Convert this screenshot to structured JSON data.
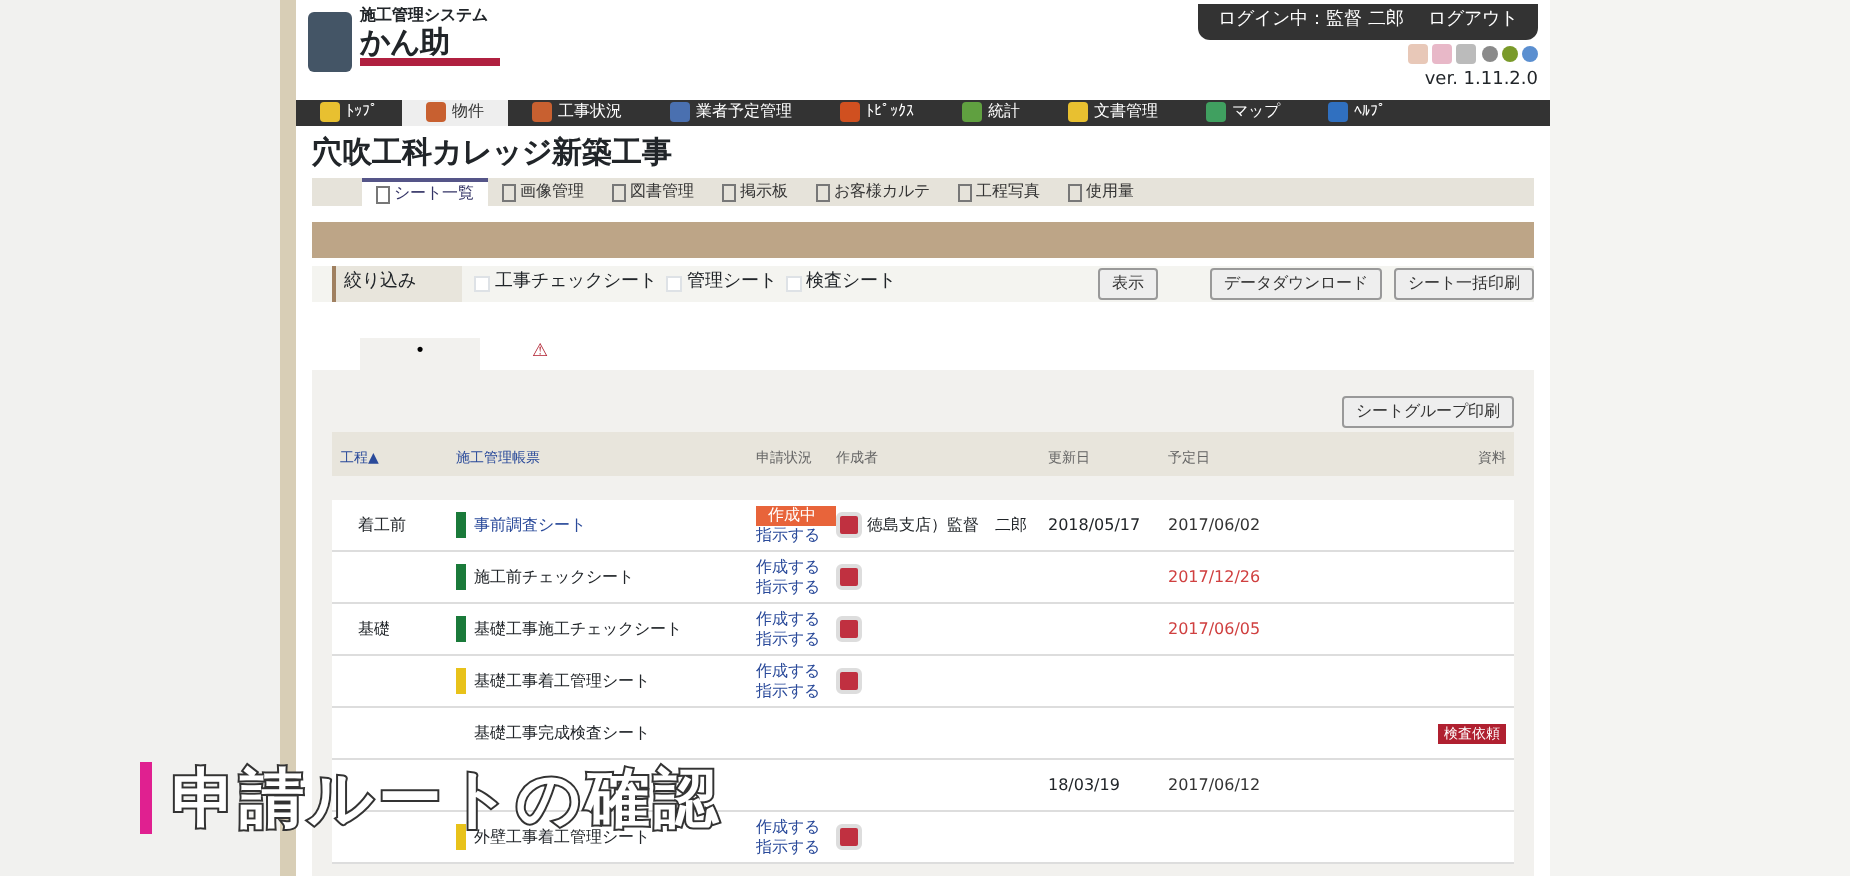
{
  "header": {
    "system_name": "施工管理システム",
    "logo_text": "かん助",
    "login_status": "ログイン中：監督 二郎",
    "logout": "ログアウト",
    "version": "ver. 1.11.2.0",
    "status_dots": [
      {
        "color": "#8a8a8a"
      },
      {
        "color": "#7a9a2a"
      },
      {
        "color": "#5b8fd0"
      }
    ]
  },
  "main_nav": [
    {
      "label": "ﾄｯﾌﾟ",
      "selected": false
    },
    {
      "label": "物件",
      "selected": true
    },
    {
      "label": "工事状況",
      "selected": false
    },
    {
      "label": "業者予定管理",
      "selected": false
    },
    {
      "label": "ﾄﾋﾟｯｸｽ",
      "selected": false
    },
    {
      "label": "統計",
      "selected": false
    },
    {
      "label": "文書管理",
      "selected": false
    },
    {
      "label": "マップ",
      "selected": false
    },
    {
      "label": "ﾍﾙﾌﾟ",
      "selected": false
    }
  ],
  "project_title": "穴吹工科カレッジ新築工事",
  "sub_tabs": [
    {
      "label": "シート一覧",
      "selected": true
    },
    {
      "label": "画像管理",
      "selected": false
    },
    {
      "label": "図書管理",
      "selected": false
    },
    {
      "label": "掲示板",
      "selected": false
    },
    {
      "label": "お客様カルテ",
      "selected": false
    },
    {
      "label": "工程写真",
      "selected": false
    },
    {
      "label": "使用量",
      "selected": false
    }
  ],
  "filter": {
    "label": "絞り込み",
    "options": [
      {
        "label": "工事チェックシート",
        "checked": false
      },
      {
        "label": "管理シート",
        "checked": false
      },
      {
        "label": "検査シート",
        "checked": false
      }
    ],
    "show_button": "表示",
    "download_button": "データダウンロード",
    "bulk_print_button": "シート一括印刷"
  },
  "group_tabs": [
    {
      "label": "•",
      "selected": true
    },
    {
      "label": "⚠",
      "selected": false
    }
  ],
  "group_print_button": "シートグループ印刷",
  "table": {
    "columns": [
      "工程▲",
      "施工管理帳票",
      "申請状況",
      "作成者",
      "更新日",
      "予定日",
      "資料"
    ],
    "rows": [
      {
        "phase": "着工前",
        "color": "#1a7a3a",
        "name": "事前調査シート",
        "status": {
          "kind": "badge",
          "label": "作成中"
        },
        "actions": [
          "指示する"
        ],
        "author": "徳島支店）監督　二郎",
        "updated": "2018/05/17",
        "due": "2017/06/02",
        "overdue": false
      },
      {
        "color": "#1a7a3a",
        "name": "施工前チェックシート",
        "actions": [
          "作成する",
          "指示する"
        ],
        "due": "2017/12/26",
        "overdue": true
      },
      {
        "phase": "基礎",
        "color": "#1a7a3a",
        "name": "基礎工事施工チェックシート",
        "actions": [
          "作成する",
          "指示する"
        ],
        "due": "2017/06/05",
        "overdue": true
      },
      {
        "color": "#e8c21a",
        "name": "基礎工事着工管理シート",
        "actions": [
          "作成する",
          "指示する"
        ]
      },
      {
        "name": "基礎工事完成検査シート",
        "badge": "検査依頼"
      },
      {
        "updated": "18/03/19",
        "due": "2017/06/12",
        "overdue": false
      },
      {
        "color": "#e8c21a",
        "name": "外壁工事着工管理シート",
        "actions": [
          "作成する",
          "指示する"
        ]
      }
    ]
  },
  "caption": "申請ルートの確認"
}
